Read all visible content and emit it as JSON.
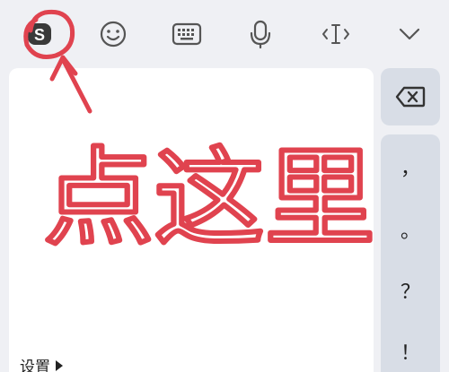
{
  "toolbar": {
    "logo_letter": "S",
    "buttons": [
      {
        "name": "sogou-logo-icon"
      },
      {
        "name": "emoji-icon"
      },
      {
        "name": "keyboard-icon"
      },
      {
        "name": "microphone-icon"
      },
      {
        "name": "cursor-icon"
      },
      {
        "name": "chevron-down-icon"
      }
    ]
  },
  "pad": {
    "settings_label": "设置"
  },
  "right_column": {
    "punctuation": [
      "，",
      "。",
      "？",
      "！"
    ]
  },
  "annotation": {
    "handwritten_text": "点这里",
    "color": "#e0434f"
  },
  "colors": {
    "background": "#eff0f4",
    "key_bg": "#d8dde6",
    "pad_bg": "#ffffff",
    "icon": "#555555"
  }
}
